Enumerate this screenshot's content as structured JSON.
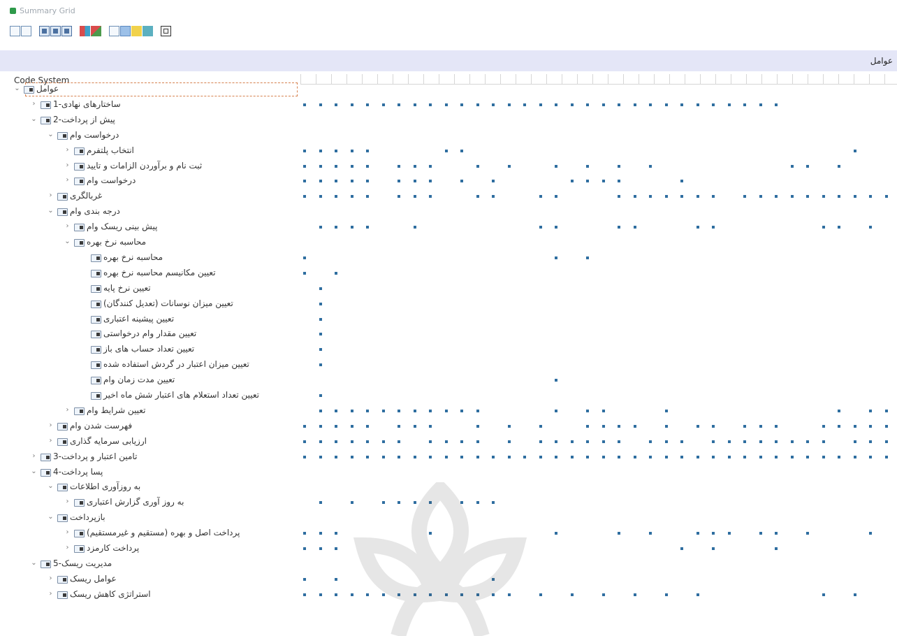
{
  "window": {
    "title": "Summary Grid"
  },
  "toolbar": {
    "buttons": [
      {
        "name": "expand-icon",
        "style": "outline"
      },
      {
        "name": "collapse-icon",
        "style": "outline"
      },
      {
        "name": "view-1-icon",
        "style": "grid"
      },
      {
        "name": "view-2-icon",
        "style": "grid"
      },
      {
        "name": "view-3-icon",
        "style": "grid"
      },
      {
        "name": "color-matrix-icon",
        "style": "red"
      },
      {
        "name": "relation-icon",
        "style": "redgrn"
      },
      {
        "name": "export-icon",
        "style": "outline"
      },
      {
        "name": "comment-icon",
        "style": "blue"
      },
      {
        "name": "note-icon",
        "style": "yellow"
      },
      {
        "name": "table-icon",
        "style": "teal"
      },
      {
        "name": "print-icon",
        "style": "dark"
      }
    ]
  },
  "header": {
    "column_label": "عوامل"
  },
  "tree": {
    "column_label": "Code System",
    "rows": [
      {
        "label": "عوامل",
        "level": 0,
        "expand": "expanded",
        "selected": true,
        "dots": []
      },
      {
        "label": "ساختارهای نهادی-1",
        "level": 1,
        "expand": "collapsed",
        "dots": [
          0,
          1,
          2,
          3,
          4,
          5,
          6,
          7,
          8,
          9,
          10,
          11,
          12,
          13,
          14,
          15,
          16,
          17,
          18,
          19,
          20,
          21,
          22,
          23,
          24,
          25,
          26,
          27,
          28,
          29,
          30
        ]
      },
      {
        "label": "پیش از پرداخت-2",
        "level": 1,
        "expand": "expanded",
        "dots": []
      },
      {
        "label": "درخواست وام",
        "level": 2,
        "expand": "expanded",
        "dots": []
      },
      {
        "label": "انتخاب پلتفرم",
        "level": 3,
        "expand": "collapsed",
        "dots": [
          0,
          1,
          2,
          3,
          4,
          9,
          10,
          35
        ]
      },
      {
        "label": "ثبت نام و برآوردن الزامات و تایید",
        "level": 3,
        "expand": "collapsed",
        "dots": [
          0,
          1,
          2,
          3,
          4,
          6,
          7,
          8,
          11,
          13,
          16,
          18,
          20,
          22,
          31,
          32,
          34
        ]
      },
      {
        "label": "درخواست وام",
        "level": 3,
        "expand": "collapsed",
        "dots": [
          0,
          1,
          2,
          3,
          4,
          6,
          7,
          8,
          10,
          12,
          17,
          18,
          19,
          20,
          24
        ]
      },
      {
        "label": "غربالگری",
        "level": 2,
        "expand": "collapsed",
        "dots": [
          0,
          1,
          2,
          3,
          4,
          6,
          7,
          8,
          11,
          12,
          15,
          16,
          20,
          21,
          22,
          23,
          24,
          25,
          26,
          28,
          29,
          30,
          31,
          32,
          33,
          34,
          35,
          36,
          37
        ]
      },
      {
        "label": "درجه بندی وام",
        "level": 2,
        "expand": "expanded",
        "dots": []
      },
      {
        "label": "پیش بینی ریسک وام",
        "level": 3,
        "expand": "collapsed",
        "dots": [
          1,
          2,
          3,
          4,
          7,
          15,
          16,
          20,
          21,
          25,
          26,
          33,
          34,
          36
        ]
      },
      {
        "label": "محاسبه نرخ بهره",
        "level": 3,
        "expand": "expanded",
        "dots": []
      },
      {
        "label": "محاسبه نرخ بهره",
        "level": 4,
        "expand": "none",
        "dots": [
          0,
          16,
          18
        ]
      },
      {
        "label": "تعیین مکانیسم محاسبه نرخ بهره",
        "level": 4,
        "expand": "none",
        "dots": [
          0,
          2
        ]
      },
      {
        "label": "تعیین نرخ پایه",
        "level": 4,
        "expand": "none",
        "dots": [
          1
        ]
      },
      {
        "label": "تعیین میزان نوسانات (تعدیل کنندگان)",
        "level": 4,
        "expand": "none",
        "dots": [
          1
        ]
      },
      {
        "label": "تعیین پیشینه اعتباری",
        "level": 4,
        "expand": "none",
        "dots": [
          1
        ]
      },
      {
        "label": "تعیین مقدار وام درخواستی",
        "level": 4,
        "expand": "none",
        "dots": [
          1
        ]
      },
      {
        "label": "تعیین تعداد حساب های باز",
        "level": 4,
        "expand": "none",
        "dots": [
          1
        ]
      },
      {
        "label": "تعیین میزان اعتبار در گردش استفاده شده",
        "level": 4,
        "expand": "none",
        "dots": [
          1
        ]
      },
      {
        "label": "تعیین مدت زمان وام",
        "level": 4,
        "expand": "none",
        "dots": [
          16
        ]
      },
      {
        "label": "تعیین تعداد استعلام های اعتبار شش ماه اخیر",
        "level": 4,
        "expand": "none",
        "dots": [
          1
        ]
      },
      {
        "label": "تعیین شرایط وام",
        "level": 3,
        "expand": "collapsed",
        "dots": [
          1,
          2,
          3,
          4,
          5,
          6,
          7,
          8,
          9,
          10,
          11,
          16,
          18,
          19,
          23,
          34,
          36,
          37
        ]
      },
      {
        "label": "فهرست شدن وام",
        "level": 2,
        "expand": "collapsed",
        "dots": [
          0,
          1,
          2,
          3,
          4,
          6,
          7,
          8,
          11,
          13,
          15,
          18,
          19,
          20,
          21,
          23,
          25,
          26,
          28,
          29,
          30,
          33,
          34,
          35,
          36,
          37
        ]
      },
      {
        "label": "ارزیابی سرمایه گذاری",
        "level": 2,
        "expand": "collapsed",
        "dots": [
          0,
          1,
          2,
          3,
          4,
          5,
          6,
          8,
          9,
          10,
          11,
          13,
          15,
          16,
          17,
          18,
          19,
          20,
          22,
          23,
          24,
          26,
          27,
          28,
          29,
          30,
          31,
          32,
          33,
          35,
          36,
          37
        ]
      },
      {
        "label": "تامین اعتبار و پرداخت-3",
        "level": 1,
        "expand": "collapsed",
        "dots": [
          0,
          1,
          2,
          3,
          4,
          5,
          6,
          7,
          8,
          9,
          10,
          11,
          12,
          13,
          14,
          15,
          16,
          17,
          18,
          19,
          20,
          21,
          22,
          23,
          24,
          25,
          26,
          27,
          28,
          29,
          30,
          31,
          32,
          33,
          34,
          35,
          36,
          37
        ]
      },
      {
        "label": "پسا پرداخت-4",
        "level": 1,
        "expand": "expanded",
        "dots": []
      },
      {
        "label": "به روزآوری اطلاعات",
        "level": 2,
        "expand": "expanded",
        "dots": []
      },
      {
        "label": "به روز آوری گزارش اعتباری",
        "level": 3,
        "expand": "collapsed",
        "dots": [
          1,
          3,
          5,
          6,
          7,
          8,
          10,
          11,
          12
        ]
      },
      {
        "label": "بازپرداخت",
        "level": 2,
        "expand": "expanded",
        "dots": []
      },
      {
        "label": "پرداخت اصل و بهره (مستقیم و غیرمستقیم)",
        "level": 3,
        "expand": "collapsed",
        "dots": [
          0,
          1,
          2,
          8,
          16,
          20,
          22,
          25,
          26,
          27,
          29,
          30,
          32,
          36
        ]
      },
      {
        "label": "پرداخت کارمزد",
        "level": 3,
        "expand": "collapsed",
        "dots": [
          0,
          1,
          2,
          24,
          26,
          30
        ]
      },
      {
        "label": "مدیریت ریسک-5",
        "level": 1,
        "expand": "expanded",
        "dots": []
      },
      {
        "label": "عوامل ریسک",
        "level": 2,
        "expand": "collapsed",
        "dots": [
          0,
          2,
          12
        ]
      },
      {
        "label": "استراتژی کاهش ریسک",
        "level": 2,
        "expand": "collapsed",
        "dots": [
          0,
          1,
          2,
          3,
          4,
          5,
          6,
          7,
          8,
          9,
          10,
          11,
          12,
          13,
          15,
          17,
          19,
          21,
          23,
          25,
          33,
          35
        ]
      }
    ]
  }
}
